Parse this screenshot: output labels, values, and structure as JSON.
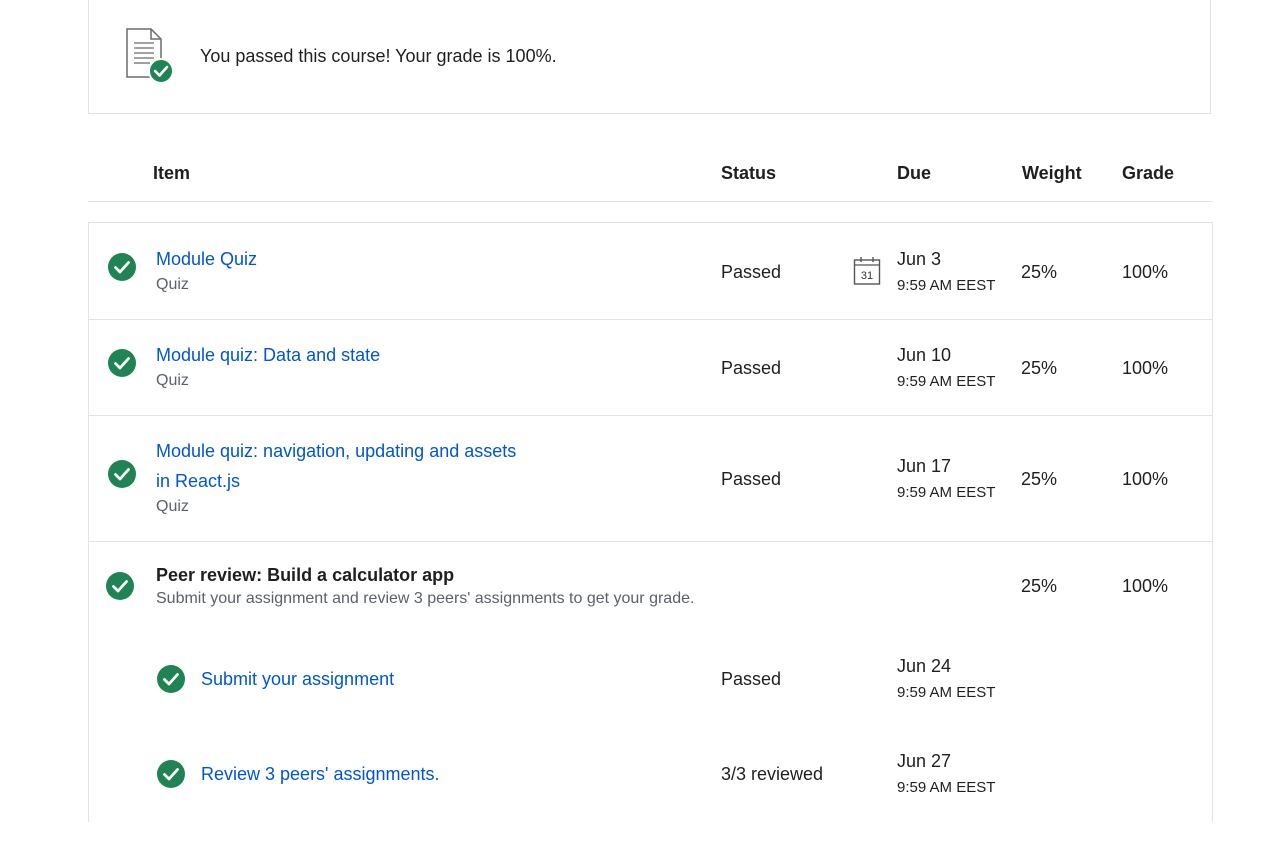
{
  "banner": {
    "icon": "document-check-icon",
    "message": "You passed this course! Your grade is 100%."
  },
  "table": {
    "headers": {
      "item": "Item",
      "status": "Status",
      "due": "Due",
      "weight": "Weight",
      "grade": "Grade"
    },
    "rows": [
      {
        "title": "Module Quiz",
        "type": "Quiz",
        "status": "Passed",
        "due_date": "Jun 3",
        "due_time": "9:59 AM EEST",
        "calendar_icon_day": "31",
        "weight": "25%",
        "grade": "100%"
      },
      {
        "title": "Module quiz: Data and state",
        "type": "Quiz",
        "status": "Passed",
        "due_date": "Jun 10",
        "due_time": "9:59 AM EEST",
        "weight": "25%",
        "grade": "100%"
      },
      {
        "title_line1": "Module quiz: navigation, updating and assets",
        "title_line2": "in React.js",
        "type": "Quiz",
        "status": "Passed",
        "due_date": "Jun 17",
        "due_time": "9:59 AM EEST",
        "weight": "25%",
        "grade": "100%"
      }
    ],
    "peer_review": {
      "title": "Peer review: Build a calculator app",
      "description": "Submit your assignment and review 3 peers' assignments to get your grade.",
      "weight": "25%",
      "grade": "100%",
      "subitems": [
        {
          "title": "Submit your assignment",
          "status": "Passed",
          "due_date": "Jun 24",
          "due_time": "9:59 AM EEST"
        },
        {
          "title": "Review 3 peers' assignments.",
          "status": "3/3 reviewed",
          "due_date": "Jun 27",
          "due_time": "9:59 AM EEST"
        }
      ]
    }
  },
  "colors": {
    "success_green": "#1f8354",
    "link_blue": "#0056d2",
    "border": "#e3e3e3"
  }
}
